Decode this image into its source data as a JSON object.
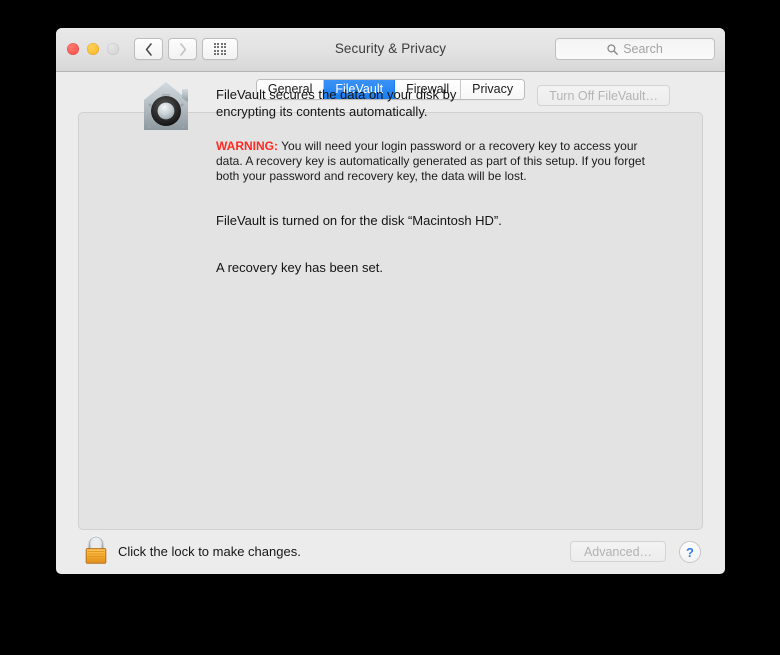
{
  "window": {
    "title": "Security & Privacy",
    "traffic_lights": {
      "close_label": "close",
      "minimize_label": "minimize",
      "zoom_label": "zoom"
    },
    "nav": {
      "back_label": "Back",
      "forward_label": "Forward",
      "show_all_label": "Show All"
    },
    "search": {
      "placeholder": "Search",
      "value": ""
    }
  },
  "tabs": [
    {
      "label": "General",
      "selected": false
    },
    {
      "label": "FileVault",
      "selected": true
    },
    {
      "label": "Firewall",
      "selected": false
    },
    {
      "label": "Privacy",
      "selected": false
    }
  ],
  "main": {
    "icon_name": "filevault-house-safe-icon",
    "headline": "FileVault secures the data on your disk by encrypting its contents automatically.",
    "warning_label": "WARNING:",
    "warning_text": " You will need your login password or a recovery key to access your data. A recovery key is automatically generated as part of this setup. If you forget both your password and recovery key, the data will be lost.",
    "status_line_1": "FileVault is turned on for the disk “Macintosh HD”.",
    "status_line_2": "A recovery key has been set.",
    "turn_off_button": {
      "label": "Turn Off FileVault…",
      "enabled": false
    }
  },
  "footer": {
    "lock_icon_name": "closed-padlock-icon",
    "lock_text": "Click the lock to make changes.",
    "advanced_button": {
      "label": "Advanced…",
      "enabled": false
    },
    "help_button": {
      "label": "?"
    }
  },
  "colors": {
    "accent_blue": "#1a7ef0",
    "warning_red": "#ff2a22",
    "help_blue": "#2f7fe8",
    "lock_gold": "#f5a623",
    "window_bg": "#ececec",
    "panel_bg": "#e3e3e3",
    "desktop_bg": "#000000"
  }
}
